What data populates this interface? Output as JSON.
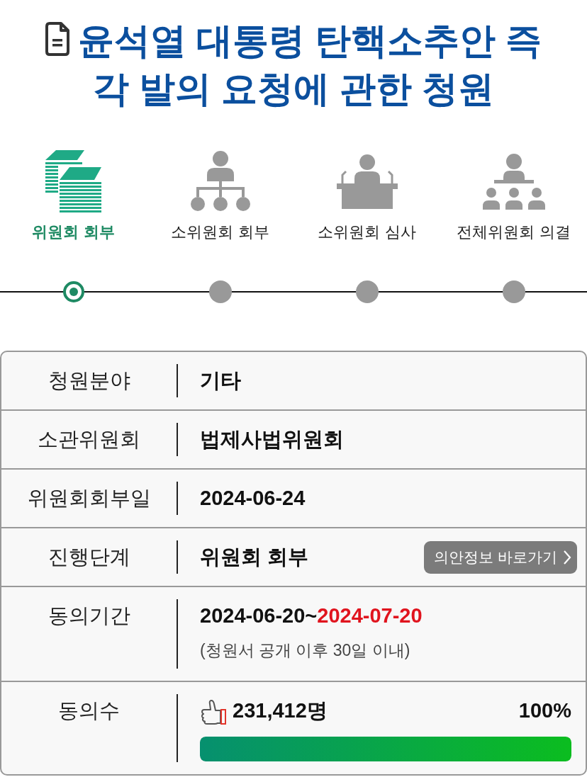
{
  "title": "윤석열 대통령 탄핵소추안 즉각 발의 요청에 관한 청원",
  "steps": [
    {
      "label": "위원회 회부",
      "selected": true
    },
    {
      "label": "소위원회 회부",
      "selected": false
    },
    {
      "label": "소위원회 심사",
      "selected": false
    },
    {
      "label": "전체위원회 의결",
      "selected": false
    }
  ],
  "details": [
    {
      "kind": "text",
      "label": "청원분야",
      "value": "기타"
    },
    {
      "kind": "text",
      "label": "소관위원회",
      "value": "법제사법위원회"
    },
    {
      "kind": "text",
      "label": "위원회회부일",
      "value": "2024-06-24"
    },
    {
      "kind": "link",
      "label": "진행단계",
      "value": "위원회 회부",
      "button": "의안정보 바로가기"
    },
    {
      "kind": "period",
      "label": "동의기간",
      "start": "2024-06-20~",
      "end": "2024-07-20",
      "note": "(청원서 공개 이후 30일 이내)"
    },
    {
      "kind": "progress",
      "label": "동의수",
      "count": "231,412명",
      "percent": "100%",
      "level": 1
    }
  ]
}
